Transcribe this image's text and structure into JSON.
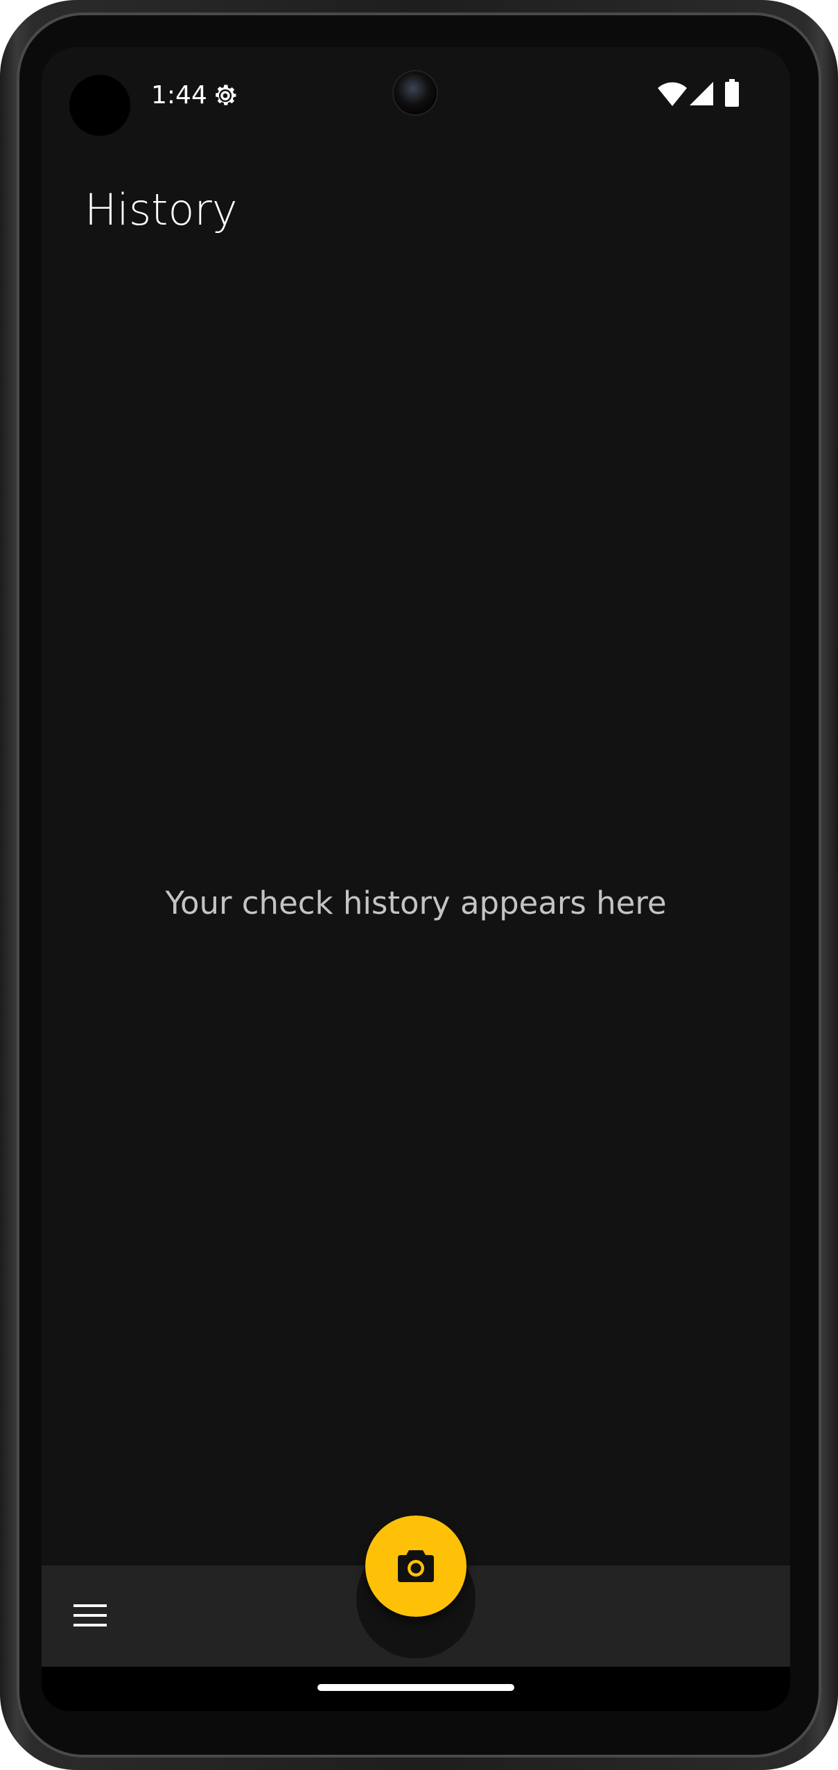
{
  "status_bar": {
    "time": "1:44",
    "icons": [
      "settings-icon",
      "wifi-icon",
      "signal-icon",
      "battery-icon"
    ]
  },
  "page": {
    "title": "History",
    "empty_message": "Your check history appears here"
  },
  "bottom_bar": {
    "menu_icon": "menu-icon",
    "fab_icon": "camera-icon"
  },
  "colors": {
    "background": "#121212",
    "bottom_bar": "#232323",
    "accent": "#ffc107",
    "text_primary": "#ffffff",
    "text_secondary": "#c4c4c4"
  }
}
